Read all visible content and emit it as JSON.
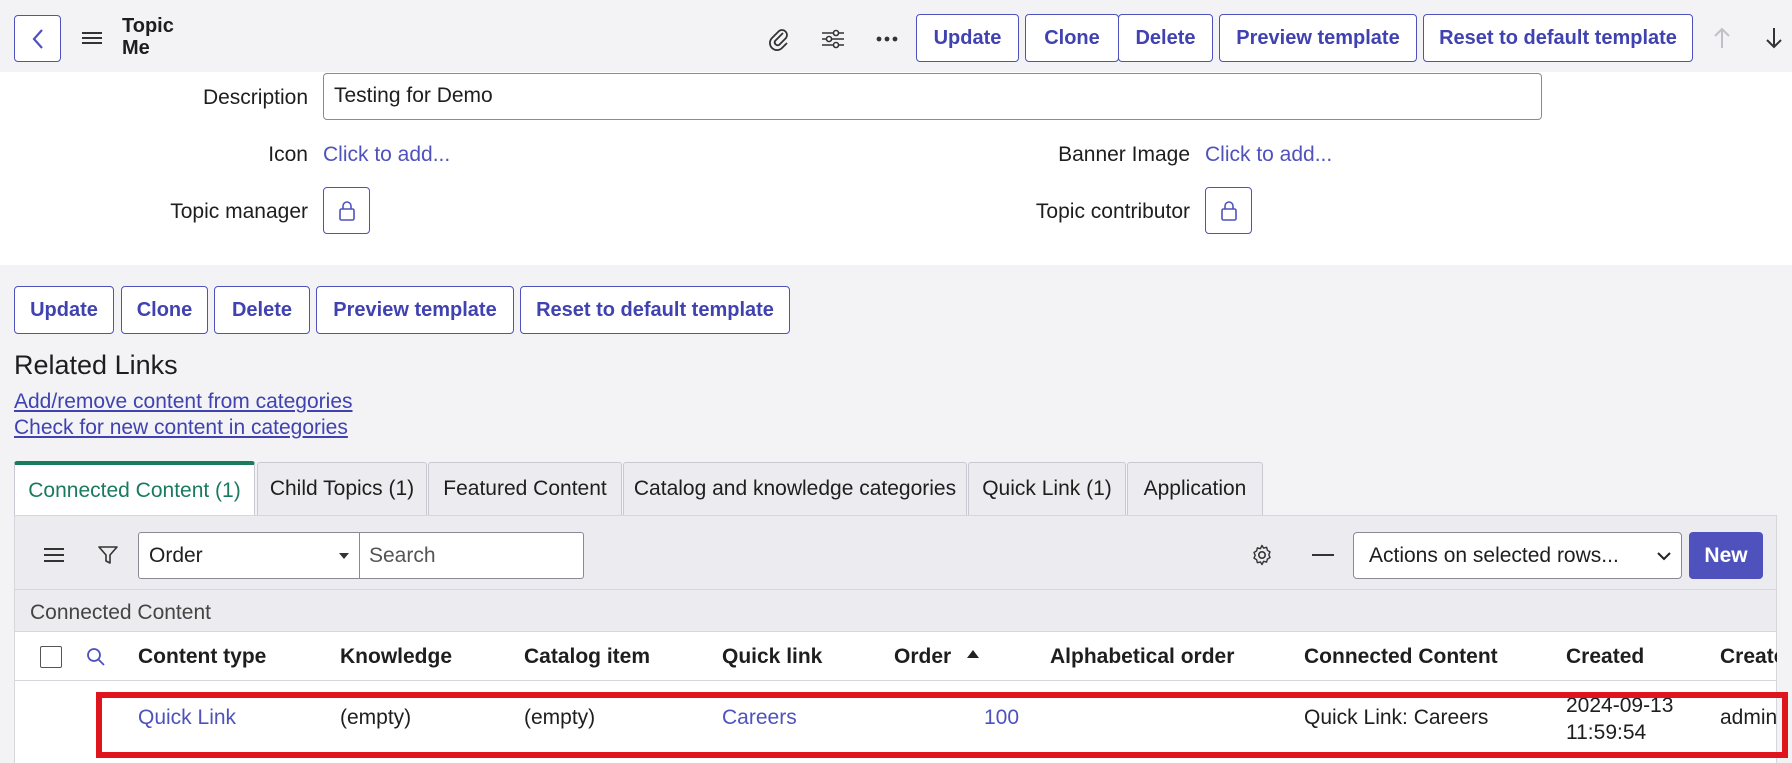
{
  "header": {
    "title_line1": "Topic",
    "title_line2": "Me",
    "buttons": {
      "update": "Update",
      "clone": "Clone",
      "delete": "Delete",
      "preview": "Preview template",
      "reset": "Reset to default template"
    }
  },
  "form": {
    "description_label": "Description",
    "description_value": "Testing for Demo",
    "icon_label": "Icon",
    "icon_value": "Click to add...",
    "banner_label": "Banner Image",
    "banner_value": "Click to add...",
    "manager_label": "Topic manager",
    "contributor_label": "Topic contributor"
  },
  "bottom_buttons": {
    "update": "Update",
    "clone": "Clone",
    "delete": "Delete",
    "preview": "Preview template",
    "reset": "Reset to default template"
  },
  "related": {
    "title": "Related Links",
    "link1": "Add/remove content from categories",
    "link2": "Check for new content in categories"
  },
  "tabs": [
    "Connected Content (1)",
    "Child Topics (1)",
    "Featured Content",
    "Catalog and knowledge categories",
    "Quick Link (1)",
    "Application"
  ],
  "list": {
    "filter_select": "Order",
    "search_placeholder": "Search",
    "actions_select": "Actions on selected rows...",
    "new_button": "New",
    "caption": "Connected Content",
    "columns": [
      "Content type",
      "Knowledge",
      "Catalog item",
      "Quick link",
      "Order",
      "Alphabetical order",
      "Connected Content",
      "Created",
      "Create"
    ],
    "row": {
      "content_type": "Quick Link",
      "knowledge": "(empty)",
      "catalog_item": "(empty)",
      "quick_link": "Careers",
      "order": "100",
      "alphabetical_order": "",
      "connected_content": "Quick Link: Careers",
      "created_line1": "2024-09-13",
      "created_line2": "11:59:54",
      "created_by": "admin"
    }
  },
  "colors": {
    "accent": "#4f52bd",
    "active_tab": "#1a7a60",
    "highlight": "#e0141c"
  }
}
